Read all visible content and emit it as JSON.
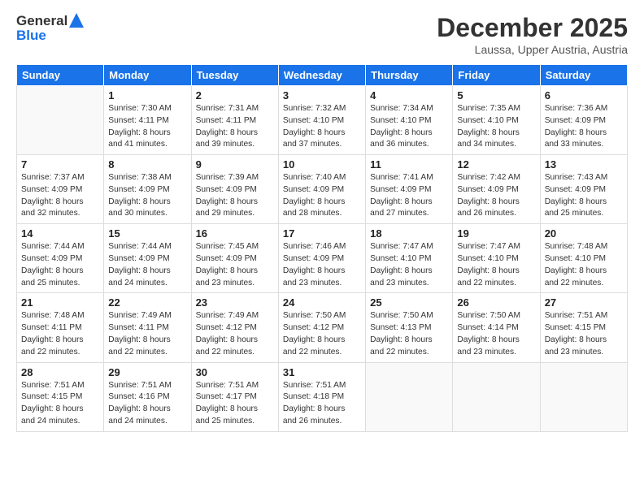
{
  "header": {
    "logo_line1": "General",
    "logo_line2": "Blue",
    "month_title": "December 2025",
    "subtitle": "Laussa, Upper Austria, Austria"
  },
  "weekdays": [
    "Sunday",
    "Monday",
    "Tuesday",
    "Wednesday",
    "Thursday",
    "Friday",
    "Saturday"
  ],
  "weeks": [
    [
      {
        "day": "",
        "info": ""
      },
      {
        "day": "1",
        "info": "Sunrise: 7:30 AM\nSunset: 4:11 PM\nDaylight: 8 hours\nand 41 minutes."
      },
      {
        "day": "2",
        "info": "Sunrise: 7:31 AM\nSunset: 4:11 PM\nDaylight: 8 hours\nand 39 minutes."
      },
      {
        "day": "3",
        "info": "Sunrise: 7:32 AM\nSunset: 4:10 PM\nDaylight: 8 hours\nand 37 minutes."
      },
      {
        "day": "4",
        "info": "Sunrise: 7:34 AM\nSunset: 4:10 PM\nDaylight: 8 hours\nand 36 minutes."
      },
      {
        "day": "5",
        "info": "Sunrise: 7:35 AM\nSunset: 4:10 PM\nDaylight: 8 hours\nand 34 minutes."
      },
      {
        "day": "6",
        "info": "Sunrise: 7:36 AM\nSunset: 4:09 PM\nDaylight: 8 hours\nand 33 minutes."
      }
    ],
    [
      {
        "day": "7",
        "info": "Sunrise: 7:37 AM\nSunset: 4:09 PM\nDaylight: 8 hours\nand 32 minutes."
      },
      {
        "day": "8",
        "info": "Sunrise: 7:38 AM\nSunset: 4:09 PM\nDaylight: 8 hours\nand 30 minutes."
      },
      {
        "day": "9",
        "info": "Sunrise: 7:39 AM\nSunset: 4:09 PM\nDaylight: 8 hours\nand 29 minutes."
      },
      {
        "day": "10",
        "info": "Sunrise: 7:40 AM\nSunset: 4:09 PM\nDaylight: 8 hours\nand 28 minutes."
      },
      {
        "day": "11",
        "info": "Sunrise: 7:41 AM\nSunset: 4:09 PM\nDaylight: 8 hours\nand 27 minutes."
      },
      {
        "day": "12",
        "info": "Sunrise: 7:42 AM\nSunset: 4:09 PM\nDaylight: 8 hours\nand 26 minutes."
      },
      {
        "day": "13",
        "info": "Sunrise: 7:43 AM\nSunset: 4:09 PM\nDaylight: 8 hours\nand 25 minutes."
      }
    ],
    [
      {
        "day": "14",
        "info": "Sunrise: 7:44 AM\nSunset: 4:09 PM\nDaylight: 8 hours\nand 25 minutes."
      },
      {
        "day": "15",
        "info": "Sunrise: 7:44 AM\nSunset: 4:09 PM\nDaylight: 8 hours\nand 24 minutes."
      },
      {
        "day": "16",
        "info": "Sunrise: 7:45 AM\nSunset: 4:09 PM\nDaylight: 8 hours\nand 23 minutes."
      },
      {
        "day": "17",
        "info": "Sunrise: 7:46 AM\nSunset: 4:09 PM\nDaylight: 8 hours\nand 23 minutes."
      },
      {
        "day": "18",
        "info": "Sunrise: 7:47 AM\nSunset: 4:10 PM\nDaylight: 8 hours\nand 23 minutes."
      },
      {
        "day": "19",
        "info": "Sunrise: 7:47 AM\nSunset: 4:10 PM\nDaylight: 8 hours\nand 22 minutes."
      },
      {
        "day": "20",
        "info": "Sunrise: 7:48 AM\nSunset: 4:10 PM\nDaylight: 8 hours\nand 22 minutes."
      }
    ],
    [
      {
        "day": "21",
        "info": "Sunrise: 7:48 AM\nSunset: 4:11 PM\nDaylight: 8 hours\nand 22 minutes."
      },
      {
        "day": "22",
        "info": "Sunrise: 7:49 AM\nSunset: 4:11 PM\nDaylight: 8 hours\nand 22 minutes."
      },
      {
        "day": "23",
        "info": "Sunrise: 7:49 AM\nSunset: 4:12 PM\nDaylight: 8 hours\nand 22 minutes."
      },
      {
        "day": "24",
        "info": "Sunrise: 7:50 AM\nSunset: 4:12 PM\nDaylight: 8 hours\nand 22 minutes."
      },
      {
        "day": "25",
        "info": "Sunrise: 7:50 AM\nSunset: 4:13 PM\nDaylight: 8 hours\nand 22 minutes."
      },
      {
        "day": "26",
        "info": "Sunrise: 7:50 AM\nSunset: 4:14 PM\nDaylight: 8 hours\nand 23 minutes."
      },
      {
        "day": "27",
        "info": "Sunrise: 7:51 AM\nSunset: 4:15 PM\nDaylight: 8 hours\nand 23 minutes."
      }
    ],
    [
      {
        "day": "28",
        "info": "Sunrise: 7:51 AM\nSunset: 4:15 PM\nDaylight: 8 hours\nand 24 minutes."
      },
      {
        "day": "29",
        "info": "Sunrise: 7:51 AM\nSunset: 4:16 PM\nDaylight: 8 hours\nand 24 minutes."
      },
      {
        "day": "30",
        "info": "Sunrise: 7:51 AM\nSunset: 4:17 PM\nDaylight: 8 hours\nand 25 minutes."
      },
      {
        "day": "31",
        "info": "Sunrise: 7:51 AM\nSunset: 4:18 PM\nDaylight: 8 hours\nand 26 minutes."
      },
      {
        "day": "",
        "info": ""
      },
      {
        "day": "",
        "info": ""
      },
      {
        "day": "",
        "info": ""
      }
    ]
  ]
}
